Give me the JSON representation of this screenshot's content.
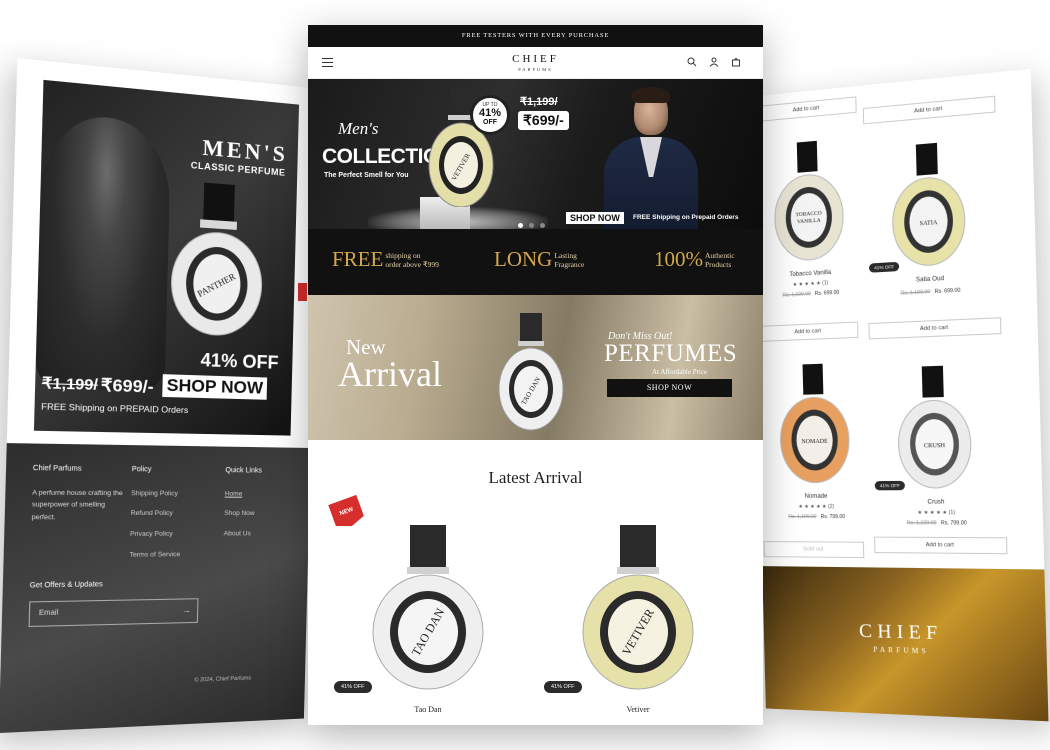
{
  "announcement": "FREE TESTERS WITH EVERY PURCHASE",
  "brand": {
    "name": "CHIEF",
    "sub": "PARFUMS"
  },
  "header_icons": [
    "menu-icon",
    "search-icon",
    "account-icon",
    "cart-icon"
  ],
  "hero": {
    "script": "Men's",
    "collection": "COLLECTION",
    "tagline": "The Perfect Smell for You",
    "upto_label": "UP TO",
    "upto_value": "41%",
    "upto_off": "OFF",
    "price_old": "₹1,199/",
    "price_new": "₹699/-",
    "shop_now": "SHOP NOW",
    "shipping": "FREE Shipping on Prepaid Orders",
    "bottle_label": "VETIVER"
  },
  "usp": [
    {
      "big": "FREE",
      "small_1": "shipping on",
      "small_2": "order above ₹999"
    },
    {
      "big": "LONG",
      "small_1": "Lasting",
      "small_2": "Fragrance"
    },
    {
      "big": "100%",
      "small_1": "Authentic",
      "small_2": "Products"
    }
  ],
  "arrival_banner": {
    "new": "New",
    "arrival": "Arrival",
    "bottle_label": "TAO DAN",
    "dont_miss": "Don't Miss Out!",
    "perfumes": "PERFUMES",
    "affordable": "At Affordable Price",
    "shop_now": "SHOP NOW"
  },
  "latest": {
    "title": "Latest Arrival",
    "ribbon": "NEW",
    "products": [
      {
        "name": "Tao Dan",
        "badge": "41% OFF",
        "label": "TAO DAN"
      },
      {
        "name": "Vetiver",
        "badge": "41% OFF",
        "label": "VETIVER"
      }
    ]
  },
  "left": {
    "title": "MEN'S",
    "subtitle": "CLASSIC PERFUME",
    "bottle_label": "PANTHER",
    "off": "41% OFF",
    "price_old": "₹1,199/",
    "price_new": "₹699/-",
    "shop_now": "SHOP NOW",
    "shipping": "FREE Shipping on PREPAID Orders",
    "footer": {
      "about_title": "Chief Parfums",
      "about_text": "A perfume house crafting the superpower of smelling perfect.",
      "policy_title": "Policy",
      "policy_links": [
        "Shipping Policy",
        "Refund Policy",
        "Privacy Policy",
        "Terms of Service"
      ],
      "quick_title": "Quick Links",
      "quick_links": [
        "Home",
        "Shop Now",
        "About Us"
      ],
      "offers_title": "Get Offers & Updates",
      "email_placeholder": "Email",
      "copyright": "© 2024, Chief Parfums"
    }
  },
  "right": {
    "top_buttons": [
      "Add to cart",
      "Add to cart"
    ],
    "products": [
      {
        "name": "Tobacco Vanilla",
        "stars": "★ ★ ★ ★ ★",
        "reviews": "(1)",
        "price_old": "Rs. 1,199.00",
        "price_new": "Rs. 699.00",
        "button": "Add to cart",
        "label": "TOBACCO VANILLA",
        "color": "#e8e4d4"
      },
      {
        "name": "Satia Oud",
        "stars": "",
        "reviews": "",
        "price_old": "Rs. 1,199.00",
        "price_new": "Rs. 699.00",
        "button": "Add to cart",
        "badge": "41% OFF",
        "label": "SATIA OUD",
        "color": "#e6e2a8"
      },
      {
        "name": "Nomade",
        "stars": "★ ★ ★ ★ ★",
        "reviews": "(2)",
        "price_old": "Rs. 1,199.00",
        "price_new": "Rs. 799.00",
        "button": "Sold out",
        "label": "NOMADE",
        "color": "#e8a060"
      },
      {
        "name": "Crush",
        "stars": "★ ★ ★ ★ ★",
        "reviews": "(1)",
        "price_old": "Rs. 1,199.00",
        "price_new": "Rs. 799.00",
        "button": "Add to cart",
        "badge": "41% OFF",
        "label": "CRUSH",
        "color": "#ececec"
      }
    ],
    "brand_name": "CHIEF",
    "brand_sub": "PARFUMS"
  }
}
